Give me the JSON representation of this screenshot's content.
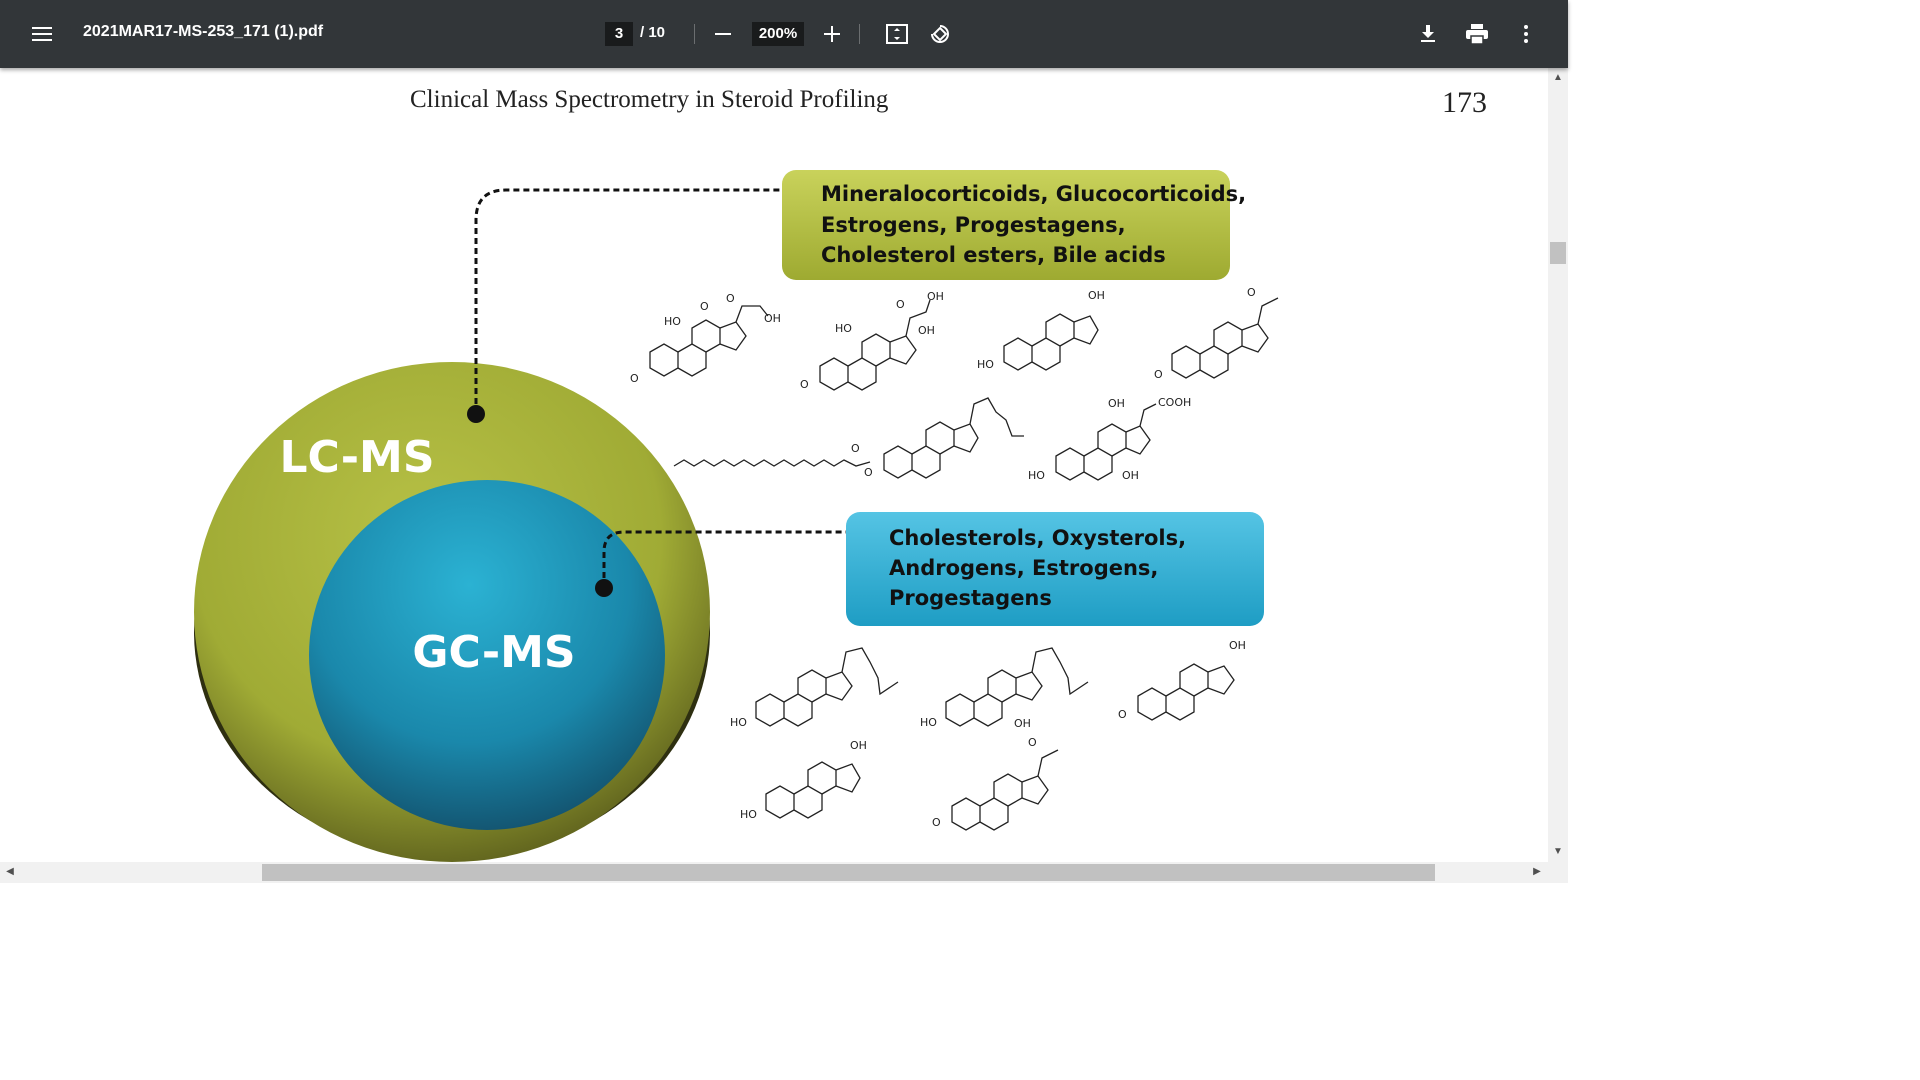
{
  "toolbar": {
    "filename": "2021MAR17-MS-253_171 (1).pdf",
    "current_page": "3",
    "total_pages": "/ 10",
    "zoom": "200%",
    "menu_icon": "hamburger-menu-icon",
    "zoom_out_icon": "minus-icon",
    "zoom_in_icon": "plus-icon",
    "fit_icon": "fit-to-page-icon",
    "rotate_icon": "rotate-icon",
    "download_icon": "download-icon",
    "print_icon": "print-icon",
    "more_icon": "more-vert-icon"
  },
  "page": {
    "running_head": "Clinical Mass Spectrometry in Steroid Profiling",
    "page_number": "173"
  },
  "figure": {
    "outer_label": "LC-MS",
    "inner_label": "GC-MS",
    "lc_box": [
      "Mineralocorticoids, Glucocorticoids,",
      "Estrogens, Progestagens,",
      "Cholesterol esters, Bile acids"
    ],
    "gc_box": [
      "Cholesterols, Oxysterols,",
      "Androgens, Estrogens,",
      "Progestagens"
    ],
    "colors": {
      "olive": "#a8b43a",
      "teal": "#1e9dbf",
      "lc_box": "#b6c245",
      "gc_box": "#3ab3d8"
    },
    "chem_labels": {
      "a_ho": "HO",
      "a_o1": "O",
      "a_o2": "O",
      "a_o3": "O",
      "a_oh": "OH",
      "b_ho": "HO",
      "b_o1": "O",
      "b_o2": "O",
      "b_oh1": "OH",
      "b_oh2": "OH",
      "c_ho": "HO",
      "c_oh": "OH",
      "d_o1": "O",
      "d_o2": "O",
      "e_o1": "O",
      "e_o2": "O",
      "f_oh1": "OH",
      "f_cooh": "COOH",
      "f_ho": "HO",
      "f_oh2": "OH",
      "g_ho": "HO",
      "h_ho": "HO",
      "h_oh": "OH",
      "i_o": "O",
      "i_oh": "OH",
      "j_ho": "HO",
      "j_oh": "OH",
      "k_o1": "O",
      "k_o2": "O"
    }
  }
}
